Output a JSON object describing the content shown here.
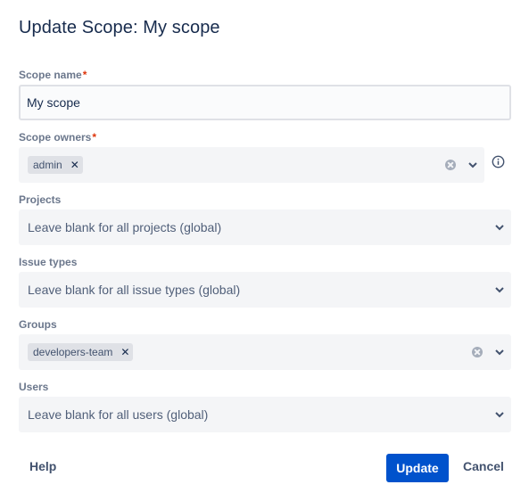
{
  "dialog": {
    "title": "Update Scope: My scope"
  },
  "fields": {
    "scope_name": {
      "label": "Scope name",
      "required_mark": "*",
      "value": "My scope"
    },
    "scope_owners": {
      "label": "Scope owners",
      "required_mark": "*",
      "tags": [
        "admin"
      ],
      "info_icon": "info-icon"
    },
    "projects": {
      "label": "Projects",
      "placeholder": "Leave blank for all projects (global)"
    },
    "issue_types": {
      "label": "Issue types",
      "placeholder": "Leave blank for all issue types (global)"
    },
    "groups": {
      "label": "Groups",
      "tags": [
        "developers-team"
      ]
    },
    "users": {
      "label": "Users",
      "placeholder": "Leave blank for all users (global)"
    }
  },
  "footer": {
    "help_label": "Help",
    "update_label": "Update",
    "cancel_label": "Cancel"
  },
  "colors": {
    "primary": "#0052cc",
    "field_bg": "#f4f5f7",
    "label": "#6b778c",
    "required": "#de350b"
  }
}
